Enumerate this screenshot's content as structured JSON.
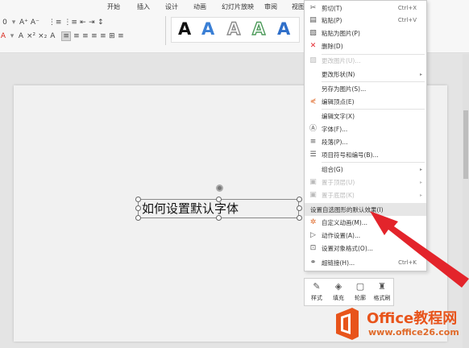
{
  "ribbon": {
    "tabs": [
      "开始",
      "插入",
      "设计",
      "动画",
      "幻灯片放映",
      "审阅",
      "视图"
    ],
    "row1_left": [
      "0",
      "A⁺",
      "A⁻",
      "⋮≡",
      "⋮≡",
      "⇤",
      "⇥",
      "↕"
    ],
    "row2_left": [
      "A",
      "A",
      "×²",
      "×₂",
      "A",
      "≡",
      "≡",
      "≡",
      "≡",
      "≡",
      "⊞",
      "≡"
    ],
    "art_letters": [
      "A",
      "A",
      "A",
      "A",
      "A"
    ]
  },
  "slide": {
    "textbox_text": "如何设置默认字体"
  },
  "context_menu": {
    "items": [
      {
        "icon": "scissors-icon",
        "glyph": "✂",
        "label": "剪切(T)",
        "shortcut": "Ctrl+X",
        "disabled": false
      },
      {
        "icon": "paste-icon",
        "glyph": "▤",
        "label": "粘贴(P)",
        "shortcut": "Ctrl+V",
        "disabled": false
      },
      {
        "icon": "paste-picture-icon",
        "glyph": "▧",
        "label": "粘贴为图片(P)",
        "shortcut": "",
        "disabled": false
      },
      {
        "icon": "delete-icon",
        "glyph": "✕",
        "label": "删除(D)",
        "shortcut": "",
        "disabled": false
      },
      {
        "icon": "change-picture-icon",
        "glyph": "▨",
        "label": "更改图片(U)...",
        "shortcut": "",
        "disabled": true
      },
      {
        "icon": "",
        "glyph": "",
        "label": "更改形状(N)",
        "shortcut": "",
        "disabled": false,
        "submenu": true
      },
      {
        "icon": "",
        "glyph": "",
        "label": "另存为图片(S)...",
        "shortcut": "",
        "disabled": false
      },
      {
        "icon": "edit-points-icon",
        "glyph": "⋞",
        "label": "编辑顶点(E)",
        "shortcut": "",
        "disabled": false
      },
      {
        "icon": "",
        "glyph": "",
        "label": "编辑文字(X)",
        "shortcut": "",
        "disabled": false
      },
      {
        "icon": "font-icon",
        "glyph": "Ⓐ",
        "label": "字体(F)...",
        "shortcut": "",
        "disabled": false
      },
      {
        "icon": "paragraph-icon",
        "glyph": "≡",
        "label": "段落(P)...",
        "shortcut": "",
        "disabled": false
      },
      {
        "icon": "bullets-icon",
        "glyph": "☰",
        "label": "项目符号和编号(B)...",
        "shortcut": "",
        "disabled": false
      },
      {
        "icon": "",
        "glyph": "",
        "label": "组合(G)",
        "shortcut": "",
        "disabled": false,
        "submenu": true
      },
      {
        "icon": "bring-front-icon",
        "glyph": "▣",
        "label": "置于顶层(U)",
        "shortcut": "",
        "disabled": true,
        "submenu": true
      },
      {
        "icon": "send-back-icon",
        "glyph": "▣",
        "label": "置于底层(K)",
        "shortcut": "",
        "disabled": true,
        "submenu": true
      },
      {
        "icon": "",
        "glyph": "",
        "label": "设置自选图形的默认效果(I)",
        "shortcut": "",
        "disabled": false,
        "highlight": true
      },
      {
        "icon": "custom-animation-icon",
        "glyph": "✲",
        "label": "自定义动画(M)...",
        "shortcut": "",
        "disabled": false
      },
      {
        "icon": "action-settings-icon",
        "glyph": "▷",
        "label": "动作设置(A)...",
        "shortcut": "",
        "disabled": false
      },
      {
        "icon": "format-object-icon",
        "glyph": "⊡",
        "label": "设置对象格式(O)...",
        "shortcut": "",
        "disabled": false
      },
      {
        "icon": "hyperlink-icon",
        "glyph": "⚭",
        "label": "超链接(H)...",
        "shortcut": "Ctrl+K",
        "disabled": false
      }
    ]
  },
  "mini_toolbar": {
    "buttons": [
      {
        "icon": "style-brush-icon",
        "glyph": "✎",
        "label": "样式"
      },
      {
        "icon": "fill-bucket-icon",
        "glyph": "◈",
        "label": "填充"
      },
      {
        "icon": "outline-icon",
        "glyph": "▢",
        "label": "轮廓"
      },
      {
        "icon": "format-painter-icon",
        "glyph": "♜",
        "label": "格式刷"
      }
    ]
  },
  "watermark": {
    "title": "Office教程网",
    "url": "www.office26.com"
  },
  "colors": {
    "accent_red": "#e3242b",
    "watermark_orange": "#e8541b"
  }
}
